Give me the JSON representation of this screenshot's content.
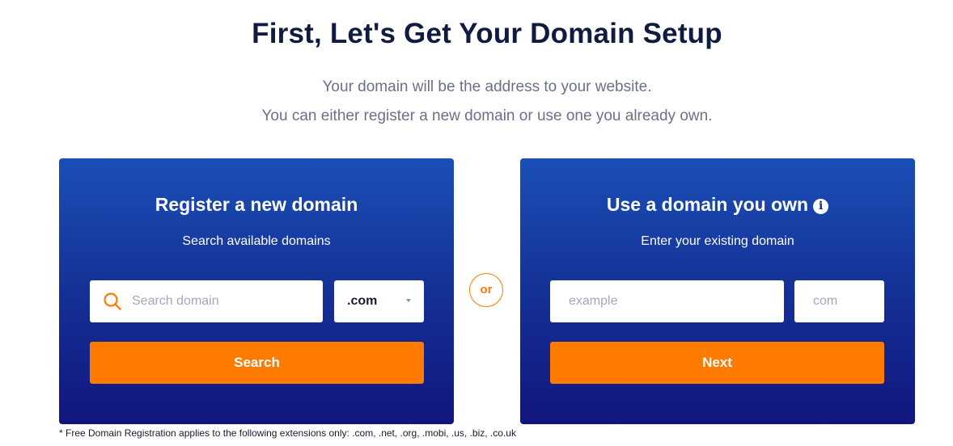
{
  "page": {
    "title": "First, Let's Get Your Domain Setup",
    "subtitle_line1": "Your domain will be the address to your website.",
    "subtitle_line2": "You can either register a new domain or use one you already own."
  },
  "register_card": {
    "title": "Register a new domain",
    "subtitle": "Search available domains",
    "search_placeholder": "Search domain",
    "search_value": "",
    "search_icon": "search-icon",
    "tld_selected": ".com",
    "button_label": "Search"
  },
  "divider": {
    "label": "or"
  },
  "own_card": {
    "title": "Use a domain you own",
    "info_icon": "info-icon",
    "subtitle": "Enter your existing domain",
    "domain_placeholder": "example",
    "domain_value": "",
    "extension_placeholder": "com",
    "extension_value": "",
    "button_label": "Next"
  },
  "footnote": "* Free Domain Registration applies to the following extensions only: .com, .net, .org, .mobi, .us, .biz, .co.uk",
  "colors": {
    "accent": "#ff7a00",
    "card_top": "#1b4fb6",
    "card_bottom": "#11167e",
    "title": "#0f1c3f",
    "subtitle": "#6b7089"
  }
}
